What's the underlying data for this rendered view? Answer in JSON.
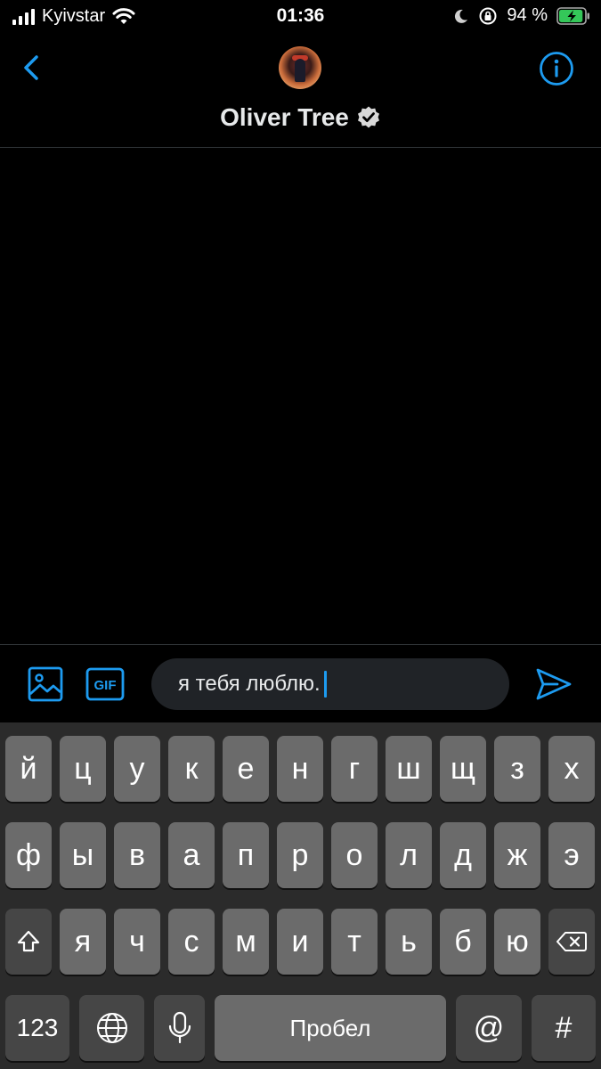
{
  "status_bar": {
    "carrier": "Kyivstar",
    "time": "01:36",
    "battery_percent": "94 %",
    "battery_level": 0.94
  },
  "header": {
    "contact_name": "Oliver Tree",
    "verified": true
  },
  "composer": {
    "message_text": "я тебя люблю."
  },
  "keyboard": {
    "row1": [
      "й",
      "ц",
      "у",
      "к",
      "е",
      "н",
      "г",
      "ш",
      "щ",
      "з",
      "х"
    ],
    "row2": [
      "ф",
      "ы",
      "в",
      "а",
      "п",
      "р",
      "о",
      "л",
      "д",
      "ж",
      "э"
    ],
    "row3": [
      "я",
      "ч",
      "с",
      "м",
      "и",
      "т",
      "ь",
      "б",
      "ю"
    ],
    "numbers_label": "123",
    "space_label": "Пробел",
    "at_label": "@",
    "hash_label": "#"
  },
  "colors": {
    "accent": "#1d9bf0",
    "background": "#000000",
    "key_light": "#6b6b6b",
    "key_dark": "#464646",
    "keyboard_bg": "#2b2b2b"
  },
  "icons": [
    "signal-icon",
    "wifi-icon",
    "moon-icon",
    "orientation-lock-icon",
    "battery-icon",
    "back-arrow-icon",
    "info-icon",
    "verified-badge-icon",
    "image-icon",
    "gif-icon",
    "send-icon",
    "shift-icon",
    "backspace-icon",
    "globe-icon",
    "microphone-icon"
  ]
}
